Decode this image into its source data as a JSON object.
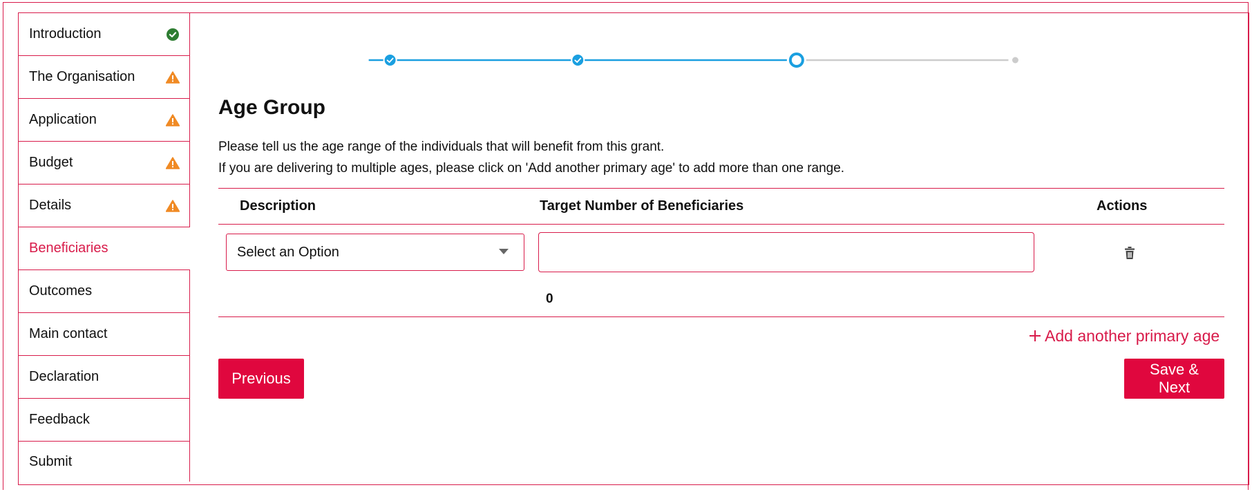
{
  "sidebar": {
    "items": [
      {
        "label": "Introduction",
        "status": "complete",
        "status_icon": "check-circle-icon",
        "status_color": "#2e7d32"
      },
      {
        "label": "The Organisation",
        "status": "warning",
        "status_icon": "warning-triangle-icon",
        "status_color": "#f08a24"
      },
      {
        "label": "Application",
        "status": "warning",
        "status_icon": "warning-triangle-icon",
        "status_color": "#f08a24"
      },
      {
        "label": "Budget",
        "status": "warning",
        "status_icon": "warning-triangle-icon",
        "status_color": "#f08a24"
      },
      {
        "label": "Details",
        "status": "warning",
        "status_icon": "warning-triangle-icon",
        "status_color": "#f08a24"
      },
      {
        "label": "Beneficiaries",
        "status": "active"
      },
      {
        "label": "Outcomes"
      },
      {
        "label": "Main contact"
      },
      {
        "label": "Declaration"
      },
      {
        "label": "Feedback"
      },
      {
        "label": "Submit"
      }
    ]
  },
  "stepper": {
    "steps": [
      "complete",
      "complete",
      "current",
      "upcoming"
    ],
    "active_color": "#1a9fe0",
    "inactive_color": "#cccccc"
  },
  "main": {
    "heading": "Age Group",
    "intro_line1": "Please tell us the age range of the individuals that will benefit from this grant.",
    "intro_line2": "If you are delivering to multiple ages, please click on 'Add another primary age' to add more than one range."
  },
  "table": {
    "headers": {
      "description": "Description",
      "target": "Target Number of Beneficiaries",
      "actions": "Actions"
    },
    "row": {
      "select_value": "Select an Option",
      "target_value": "",
      "delete_icon": "trash-icon"
    },
    "total": "0"
  },
  "actions": {
    "add_label": "Add another primary age",
    "add_icon": "plus-icon",
    "previous_label": "Previous",
    "next_label": "Save & Next"
  },
  "colors": {
    "accent": "#d81b4a",
    "button": "#e0073e"
  }
}
